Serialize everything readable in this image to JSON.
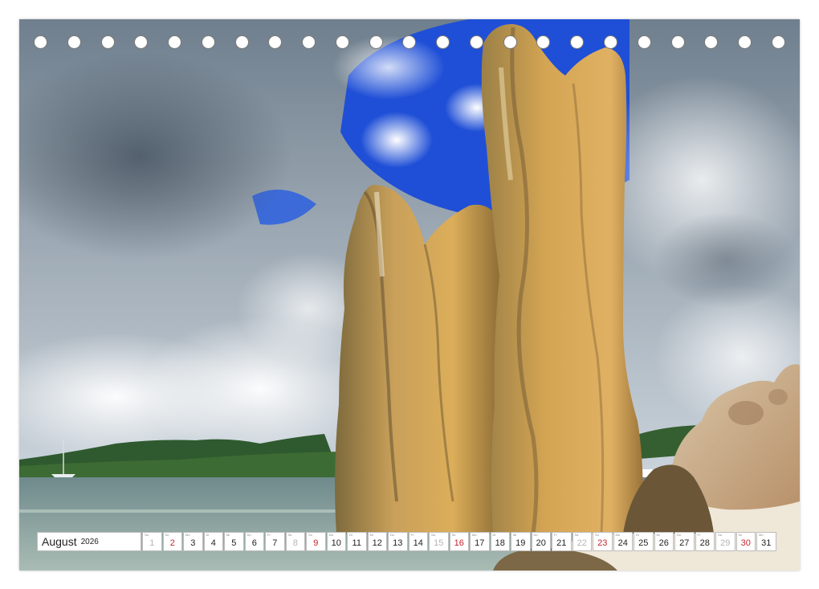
{
  "calendar": {
    "month": "August",
    "year": "2026",
    "days": [
      {
        "d": "1",
        "wd": "Sa",
        "type": "sat"
      },
      {
        "d": "2",
        "wd": "So",
        "type": "sun"
      },
      {
        "d": "3",
        "wd": "Mo",
        "type": "wk"
      },
      {
        "d": "4",
        "wd": "Di",
        "type": "wk"
      },
      {
        "d": "5",
        "wd": "Mi",
        "type": "wk"
      },
      {
        "d": "6",
        "wd": "Do",
        "type": "wk"
      },
      {
        "d": "7",
        "wd": "Fr",
        "type": "wk"
      },
      {
        "d": "8",
        "wd": "Sa",
        "type": "sat"
      },
      {
        "d": "9",
        "wd": "So",
        "type": "sun"
      },
      {
        "d": "10",
        "wd": "Mo",
        "type": "wk"
      },
      {
        "d": "11",
        "wd": "Di",
        "type": "wk"
      },
      {
        "d": "12",
        "wd": "Mi",
        "type": "wk"
      },
      {
        "d": "13",
        "wd": "Do",
        "type": "wk"
      },
      {
        "d": "14",
        "wd": "Fr",
        "type": "wk"
      },
      {
        "d": "15",
        "wd": "Sa",
        "type": "sat"
      },
      {
        "d": "16",
        "wd": "So",
        "type": "sun"
      },
      {
        "d": "17",
        "wd": "Mo",
        "type": "wk"
      },
      {
        "d": "18",
        "wd": "Di",
        "type": "wk"
      },
      {
        "d": "19",
        "wd": "Mi",
        "type": "wk"
      },
      {
        "d": "20",
        "wd": "Do",
        "type": "wk"
      },
      {
        "d": "21",
        "wd": "Fr",
        "type": "wk"
      },
      {
        "d": "22",
        "wd": "Sa",
        "type": "sat"
      },
      {
        "d": "23",
        "wd": "So",
        "type": "sun"
      },
      {
        "d": "24",
        "wd": "Mo",
        "type": "wk"
      },
      {
        "d": "25",
        "wd": "Di",
        "type": "wk"
      },
      {
        "d": "26",
        "wd": "Mi",
        "type": "wk"
      },
      {
        "d": "27",
        "wd": "Do",
        "type": "wk"
      },
      {
        "d": "28",
        "wd": "Fr",
        "type": "wk"
      },
      {
        "d": "29",
        "wd": "Sa",
        "type": "sat"
      },
      {
        "d": "30",
        "wd": "So",
        "type": "sun"
      },
      {
        "d": "31",
        "wd": "Mo",
        "type": "wk"
      }
    ]
  },
  "colors": {
    "sunday": "#c8242b",
    "saturday": "#b5b5b5",
    "sky_blue": "#1f4fd6",
    "rock": "#c89a48"
  },
  "binding_holes": 23
}
